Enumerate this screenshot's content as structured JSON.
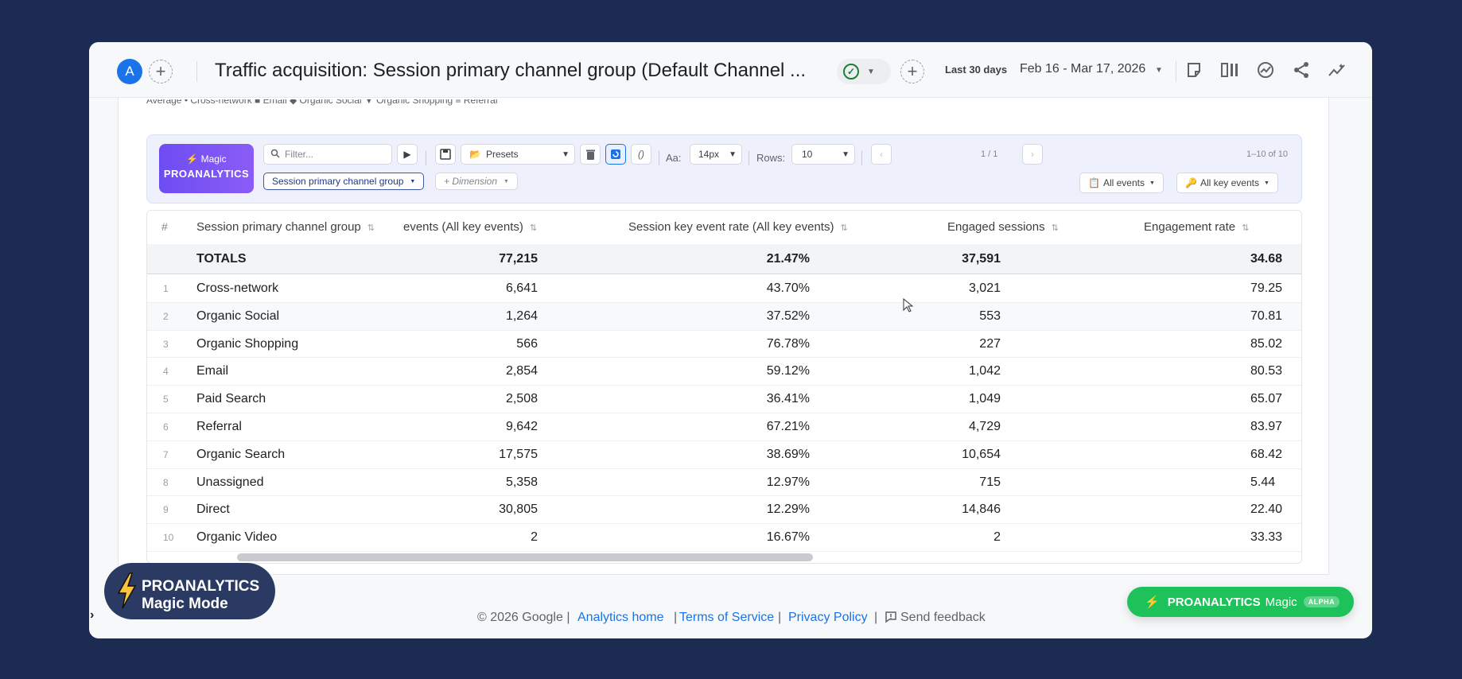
{
  "header": {
    "avatar_letter": "A",
    "add_icon": "plus-icon",
    "title": "Traffic acquisition: Session primary channel group (Default Channel ...",
    "date_label": "Last 30 days",
    "date_range": "Feb 16 - Mar 17, 2026",
    "icons": [
      "note-icon",
      "compare-icon",
      "insights-icon",
      "share-icon",
      "trend-icon"
    ]
  },
  "legend_strip": "Average  •  Cross-network  ■  Email  ◆  Organic Social  ▼  Organic Shopping  ≡  Referral",
  "toolbar": {
    "logo_line1": "Magic",
    "logo_line2": "PROANALYTICS",
    "filter_placeholder": "Filter...",
    "presets_label": "Presets",
    "font_label": "Aa:",
    "font_value": "14px",
    "rows_label": "Rows:",
    "rows_value": "10",
    "page_indicator": "1 / 1",
    "range_indicator": "1–10 of 10",
    "dimension_chip": "Session primary channel group",
    "add_dimension": "+ Dimension",
    "events_chip": "All events",
    "key_events_chip": "All key events"
  },
  "table": {
    "columns": {
      "index": "#",
      "channel": "Session primary channel group",
      "events": "events (All key events)",
      "rate": "Session key event rate (All key events)",
      "engaged": "Engaged sessions",
      "engagement": "Engagement rate"
    },
    "totals": {
      "label": "TOTALS",
      "events": "77,215",
      "rate": "21.47%",
      "engaged": "37,591",
      "engagement": "34.68"
    },
    "rows": [
      {
        "idx": "1",
        "channel": "Cross-network",
        "events": "6,641",
        "rate": "43.70%",
        "engaged": "3,021",
        "engagement": "79.25"
      },
      {
        "idx": "2",
        "channel": "Organic Social",
        "events": "1,264",
        "rate": "37.52%",
        "engaged": "553",
        "engagement": "70.81"
      },
      {
        "idx": "3",
        "channel": "Organic Shopping",
        "events": "566",
        "rate": "76.78%",
        "engaged": "227",
        "engagement": "85.02"
      },
      {
        "idx": "4",
        "channel": "Email",
        "events": "2,854",
        "rate": "59.12%",
        "engaged": "1,042",
        "engagement": "80.53"
      },
      {
        "idx": "5",
        "channel": "Paid Search",
        "events": "2,508",
        "rate": "36.41%",
        "engaged": "1,049",
        "engagement": "65.07"
      },
      {
        "idx": "6",
        "channel": "Referral",
        "events": "9,642",
        "rate": "67.21%",
        "engaged": "4,729",
        "engagement": "83.97"
      },
      {
        "idx": "7",
        "channel": "Organic Search",
        "events": "17,575",
        "rate": "38.69%",
        "engaged": "10,654",
        "engagement": "68.42"
      },
      {
        "idx": "8",
        "channel": "Unassigned",
        "events": "5,358",
        "rate": "12.97%",
        "engaged": "715",
        "engagement": "5.44"
      },
      {
        "idx": "9",
        "channel": "Direct",
        "events": "30,805",
        "rate": "12.29%",
        "engaged": "14,846",
        "engagement": "22.40"
      },
      {
        "idx": "10",
        "channel": "Organic Video",
        "events": "2",
        "rate": "16.67%",
        "engaged": "2",
        "engagement": "33.33"
      }
    ]
  },
  "footer": {
    "copyright": "© 2026 Google |",
    "analytics_home": "Analytics home",
    "terms": "Terms of Service",
    "privacy": "Privacy Policy",
    "feedback": "Send feedback"
  },
  "magic_badge": {
    "line1": "PROANALYTICS",
    "line2": "Magic Mode"
  },
  "magic_pill": {
    "brand": "PROANALYTICS",
    "word": "Magic",
    "tag": "ALPHA"
  },
  "colors": {
    "background": "#1b2b52",
    "accent": "#1a73e8",
    "magic_purple": "#7c52f4",
    "magic_green": "#1ec25b"
  }
}
